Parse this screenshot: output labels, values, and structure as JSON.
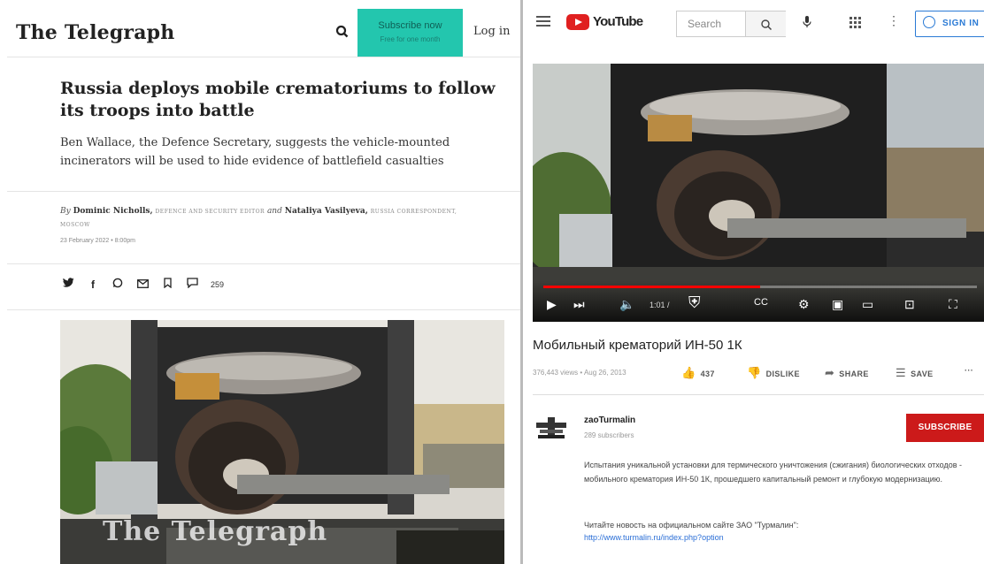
{
  "telegraph": {
    "logo": "The Telegraph",
    "subscribe_label": "Subscribe now",
    "subscribe_sub": "Free for one month",
    "login_label": "Log in",
    "headline": "Russia deploys mobile crematoriums to follow its troops into battle",
    "standfirst": "Ben Wallace, the Defence Secretary, suggests the vehicle-mounted incinerators will be used to hide evidence of battlefield casualties",
    "byline": {
      "by": "By",
      "author1": "Dominic Nicholls,",
      "role1": "DEFENCE AND SECURITY EDITOR",
      "and": "and",
      "author2": "Nataliya Vasilyeva,",
      "role2": "RUSSIA CORRESPONDENT, MOSCOW"
    },
    "date": "23 February 2022 • 8:00pm",
    "share_icons": [
      "twitter-icon",
      "facebook-icon",
      "whatsapp-icon",
      "email-icon",
      "bookmark-icon",
      "comment-icon"
    ],
    "comment_count": "259",
    "image_watermark": "The Telegraph"
  },
  "youtube": {
    "logo_text": "YouTube",
    "search_placeholder": "Search",
    "sign_in_label": "SIGN IN",
    "time_label": "1:01 /",
    "progress": 0.5,
    "video_title": "Мобильный крематорий ИН-50 1К",
    "meta": "376,443 views • Aug 26, 2013",
    "like_count": "437",
    "dislike_label": "DISLIKE",
    "share_label": "SHARE",
    "save_label": "SAVE",
    "channel_name": "zaoTurmalin",
    "subscribers": "289 subscribers",
    "subscribe_label": "SUBSCRIBE",
    "description": "Испытания уникальной установки для термического уничтожения (сжигания) биологических отходов - мобильного крематория ИН-50 1К, прошедшего капитальный ремонт и глубокую модернизацию.",
    "description2": "Читайте новость на официальном сайте ЗАО \"Турмалин\":",
    "link": "http://www.turmalin.ru/index.php?option"
  },
  "colors": {
    "telegraph_subscribe": "#23c6ae",
    "youtube_red": "#e02020",
    "youtube_blue": "#2a7ad5"
  }
}
